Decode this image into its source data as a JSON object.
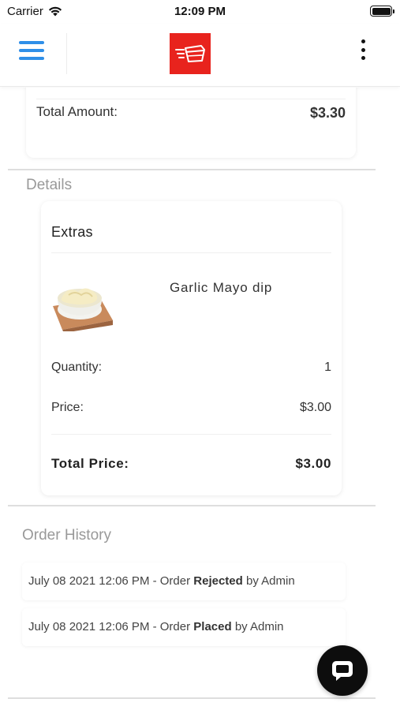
{
  "status_bar": {
    "carrier": "Carrier",
    "time": "12:09 PM"
  },
  "nav": {
    "menu_icon": "hamburger-menu-icon",
    "logo_icon": "restaurant-logo",
    "more_icon": "vertical-more-icon",
    "menu_color": "#2f8fe8",
    "logo_color": "#e8231d"
  },
  "summary": {
    "total_amount_label": "Total Amount:",
    "total_amount_value": "$3.30"
  },
  "details": {
    "section_title": "Details",
    "category": "Extras",
    "item_name": "Garlic Mayo dip",
    "quantity_label": "Quantity:",
    "quantity_value": "1",
    "price_label": "Price:",
    "price_value": "$3.00",
    "total_price_label": "Total Price:",
    "total_price_value": "$3.00"
  },
  "order_history": {
    "section_title": "Order History",
    "entries": [
      {
        "prefix": "July 08 2021 12:06 PM - Order ",
        "status": "Rejected",
        "suffix": " by Admin"
      },
      {
        "prefix": "July 08 2021 12:06 PM - Order ",
        "status": "Placed",
        "suffix": " by Admin"
      }
    ]
  },
  "chat": {
    "icon": "chat-bubble-icon"
  }
}
